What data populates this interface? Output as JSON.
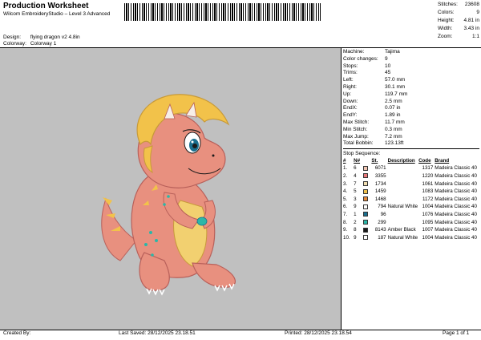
{
  "header": {
    "title": "Production Worksheet",
    "subtitle": "Wilcom EmbroideryStudio – Level 3 Advanced",
    "design_label": "Design:",
    "design_value": "flying dragon v2 4.8in",
    "colorway_label": "Colorway:",
    "colorway_value": "Colorway 1"
  },
  "stats": [
    {
      "k": "Stitches:",
      "v": "23608"
    },
    {
      "k": "Colors:",
      "v": "9"
    },
    {
      "k": "Height:",
      "v": "4.81 in"
    },
    {
      "k": "Width:",
      "v": "3.43 in"
    },
    {
      "k": "Zoom:",
      "v": "1:1"
    }
  ],
  "machine_props": [
    {
      "k": "Machine:",
      "v": "Tajima"
    },
    {
      "k": "Color changes:",
      "v": "9"
    },
    {
      "k": "Stops:",
      "v": "10"
    },
    {
      "k": "Trims:",
      "v": "45"
    },
    {
      "k": "Left:",
      "v": "57.0 mm"
    },
    {
      "k": "Right:",
      "v": "30.1 mm"
    },
    {
      "k": "Up:",
      "v": "119.7 mm"
    },
    {
      "k": "Down:",
      "v": "2.5 mm"
    },
    {
      "k": "EndX:",
      "v": "0.07 in"
    },
    {
      "k": "EndY:",
      "v": "1.89 in"
    },
    {
      "k": "Max Stitch:",
      "v": "11.7 mm"
    },
    {
      "k": "Min Stitch:",
      "v": "0.3 mm"
    },
    {
      "k": "Max Jump:",
      "v": "7.2 mm"
    },
    {
      "k": "Total Bobbin:",
      "v": "123.13ft"
    }
  ],
  "stop_sequence": {
    "label": "Stop Sequence:",
    "headers": [
      "#",
      "N#",
      "",
      "St.",
      "Description",
      "Code",
      "Brand"
    ],
    "rows": [
      {
        "n": "1.",
        "nn": "6",
        "color": "#f0c5b3",
        "code1": "6071",
        "desc": "",
        "code": "1317",
        "brand": "Madeira Classic 40"
      },
      {
        "n": "2.",
        "nn": "4",
        "color": "#e8787a",
        "code1": "3355",
        "desc": "",
        "code": "1220",
        "brand": "Madeira Classic 40"
      },
      {
        "n": "3.",
        "nn": "7",
        "color": "#f2dfb1",
        "code1": "1734",
        "desc": "",
        "code": "1061",
        "brand": "Madeira Classic 40"
      },
      {
        "n": "4.",
        "nn": "5",
        "color": "#f0c14c",
        "code1": "1459",
        "desc": "",
        "code": "1083",
        "brand": "Madeira Classic 40"
      },
      {
        "n": "5.",
        "nn": "3",
        "color": "#e8893a",
        "code1": "1468",
        "desc": "",
        "code": "1172",
        "brand": "Madeira Classic 40"
      },
      {
        "n": "6.",
        "nn": "9",
        "color": "#ffffff",
        "code1": "794",
        "desc": "Natural White",
        "code": "1004",
        "brand": "Madeira Classic 40"
      },
      {
        "n": "7.",
        "nn": "1",
        "color": "#1a6f8f",
        "code1": "96",
        "desc": "",
        "code": "1076",
        "brand": "Madeira Classic 40"
      },
      {
        "n": "8.",
        "nn": "2",
        "color": "#2bb7a8",
        "code1": "299",
        "desc": "",
        "code": "1095",
        "brand": "Madeira Classic 40"
      },
      {
        "n": "9.",
        "nn": "8",
        "color": "#1a1a1a",
        "code1": "8143",
        "desc": "Amber Black",
        "code": "1007",
        "brand": "Madeira Classic 40"
      },
      {
        "n": "10.",
        "nn": "9",
        "color": "#ffffff",
        "code1": "187",
        "desc": "Natural White",
        "code": "1004",
        "brand": "Madeira Classic 40"
      }
    ]
  },
  "footer": {
    "created_by": "Created By:",
    "last_saved": "Last Saved: 28/12/2025 23.18.51",
    "printed": "Printed: 28/12/2025 23.18.54",
    "page": "Page 1 of 1"
  },
  "colors": {
    "canvas_bg": "#c0c0c0",
    "dragon_body": "#e8907f",
    "dragon_hair": "#f2c24a",
    "dragon_belly": "#f2d070"
  }
}
